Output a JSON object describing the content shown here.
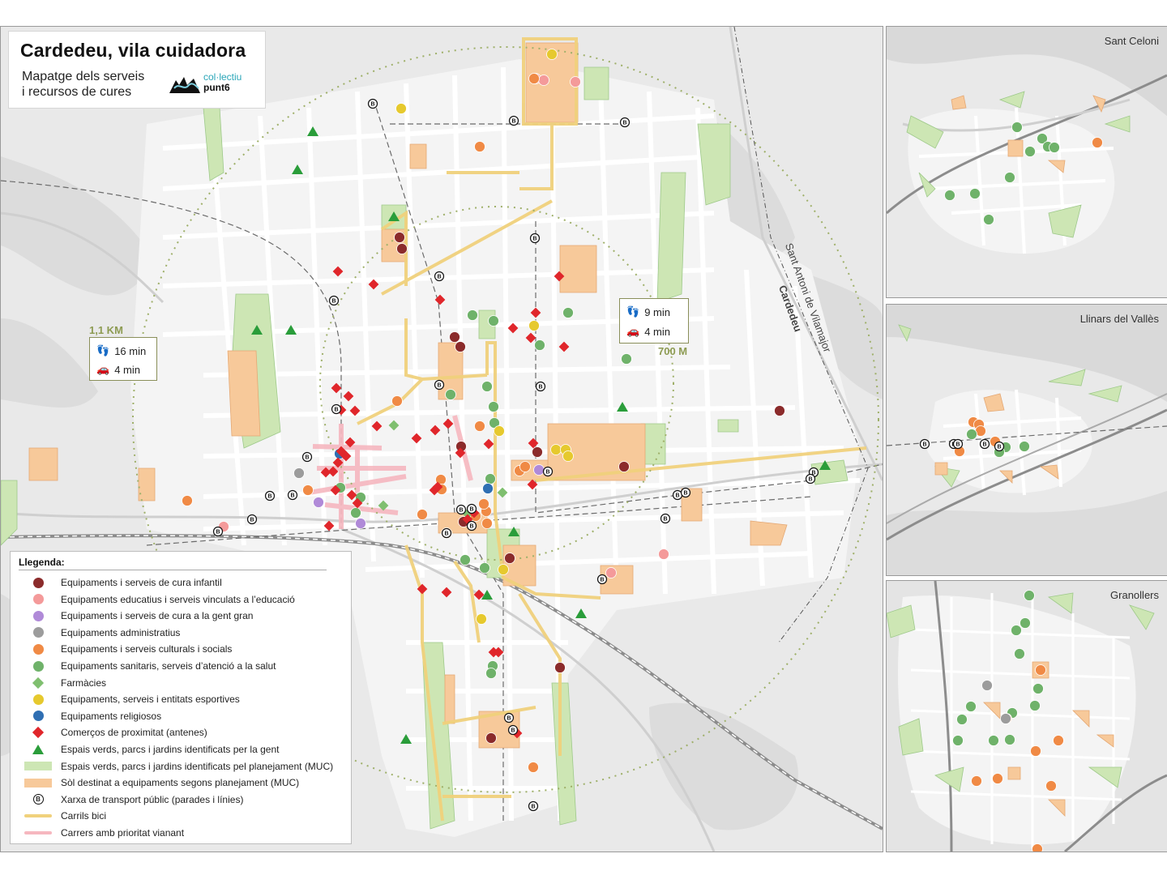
{
  "title": "Cardedeu, vila cuidadora",
  "subtitle_line1": "Mapatge dels serveis",
  "subtitle_line2": "i recursos de cures",
  "logo": {
    "line1": "col·lectiu",
    "line2": "punt6"
  },
  "colors": {
    "infantil": "#8b2b2b",
    "educatius": "#f49a9a",
    "gent_gran": "#b08ad8",
    "administratius": "#9c9c9c",
    "culturals": "#f08a45",
    "sanitaris": "#6fb26a",
    "farmacies": "#7fbf6f",
    "esportius": "#e6c92e",
    "religiosos": "#2f6fb3",
    "comercos": "#e0262b",
    "espais_gent": "#2a9d3a",
    "espais_muc": "#cde6b4",
    "sol_equip": "#f7c99a",
    "carrils_bici": "#f0d17c",
    "vianant": "#f6b7bf",
    "map_bg": "#e9e9e9",
    "block": "#f6f6f6",
    "dashed_ring": "#9fb06a"
  },
  "travel_far": {
    "walk": "16 min",
    "car": "4 min",
    "distance": "1,1 KM"
  },
  "travel_near": {
    "walk": "9 min",
    "car": "4 min",
    "distance": "700 M"
  },
  "road_labels": {
    "line1": "Sant Antoni de Vilamajor",
    "line2": "Cardedeu"
  },
  "insets": [
    {
      "name": "Sant Celoni"
    },
    {
      "name": "Llinars del Vallès"
    },
    {
      "name": "Granollers"
    }
  ],
  "legend": {
    "title": "Llegenda:",
    "items": [
      {
        "label": "Equipaments i serveis de cura infantil",
        "icon": "circle",
        "color": "#8b2b2b"
      },
      {
        "label": "Equipaments educatius i serveis vinculats a l’educació",
        "icon": "circle",
        "color": "#f49a9a"
      },
      {
        "label": "Equipaments i serveis de cura a la gent gran",
        "icon": "circle",
        "color": "#b08ad8"
      },
      {
        "label": "Equipaments administratius",
        "icon": "circle",
        "color": "#9c9c9c"
      },
      {
        "label": "Equipaments i serveis culturals i socials",
        "icon": "circle",
        "color": "#f08a45"
      },
      {
        "label": "Equipaments sanitaris, serveis d’atenció a la salut",
        "icon": "circle",
        "color": "#6fb26a"
      },
      {
        "label": "Farmàcies",
        "icon": "diamond",
        "color": "#7fbf6f"
      },
      {
        "label": "Equipaments, serveis i entitats esportives",
        "icon": "circle",
        "color": "#e6c92e"
      },
      {
        "label": "Equipaments religiosos",
        "icon": "circle",
        "color": "#2f6fb3"
      },
      {
        "label": "Comerços de proximitat (antenes)",
        "icon": "diamond",
        "color": "#e0262b"
      },
      {
        "label": "Espais verds, parcs i jardins identificats per la gent",
        "icon": "triangle",
        "color": "#2a9d3a"
      },
      {
        "label": "Espais verds, parcs i jardins identificats pel planejament (MUC)",
        "icon": "rect",
        "color": "#cde6b4"
      },
      {
        "label": "Sòl destinat a equipaments segons planejament (MUC)",
        "icon": "rect",
        "color": "#f7c99a"
      },
      {
        "label": "Xarxa de transport públic (parades i línies)",
        "icon": "bus",
        "color": "#111111"
      },
      {
        "label": "Carrils bici",
        "icon": "line",
        "color": "#f0d17c"
      },
      {
        "label": "Carrers amb prioritat vianant",
        "icon": "line",
        "color": "#f6b7bf"
      }
    ]
  }
}
